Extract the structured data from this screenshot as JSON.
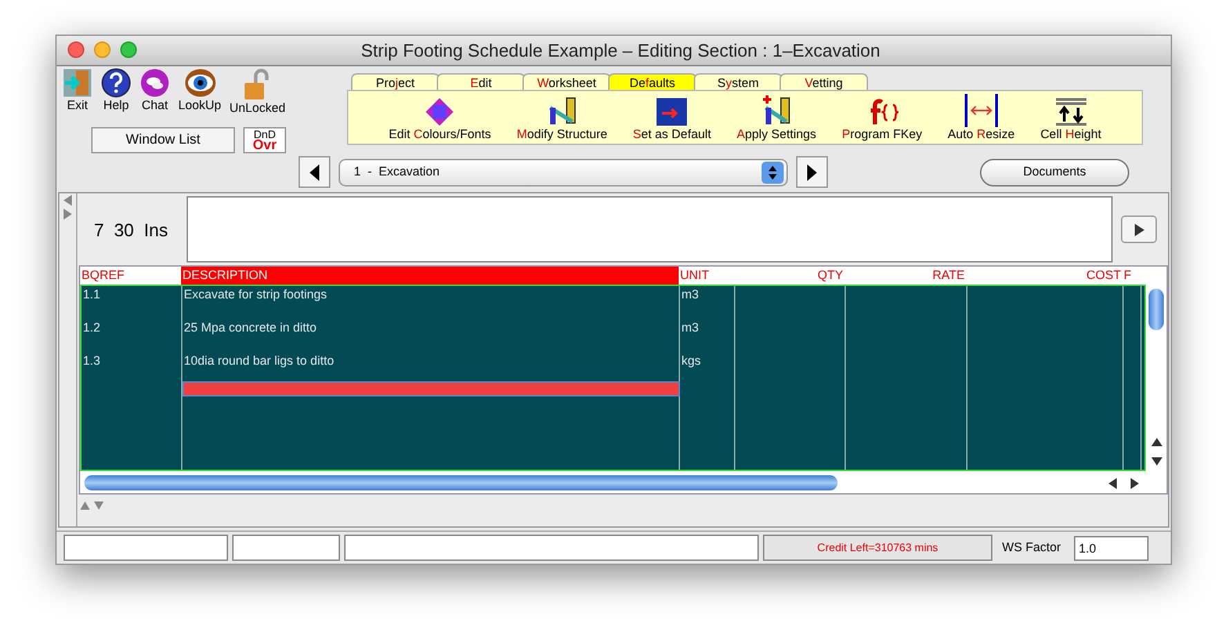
{
  "window": {
    "title": "Strip Footing Schedule Example – Editing Section : 1–Excavation"
  },
  "toolbar": {
    "buttons": [
      {
        "kind": "exit",
        "label": "Exit"
      },
      {
        "kind": "help",
        "label": "Help"
      },
      {
        "kind": "chat",
        "label": "Chat"
      },
      {
        "kind": "lookup",
        "label": "LookUp"
      },
      {
        "kind": "lock",
        "label": "UnLocked"
      }
    ],
    "window_list": "Window List",
    "dnd": {
      "top": "DnD",
      "bottom": "Ovr"
    }
  },
  "ribbon": {
    "tabs": [
      {
        "pre": "Pro",
        "key": "j",
        "post": "ect",
        "selected": false
      },
      {
        "key": "E",
        "post": "dit",
        "selected": false
      },
      {
        "key": "W",
        "post": "orksheet",
        "selected": false
      },
      {
        "pre": "De",
        "key": "f",
        "post": "aults",
        "selected": true
      },
      {
        "pre": "S",
        "key": "y",
        "post": "stem",
        "selected": false
      },
      {
        "key": "V",
        "post": "etting",
        "selected": false
      }
    ],
    "tools": [
      {
        "kind": "palette",
        "pre": "Edit ",
        "key": "C",
        "post": "olours/Fonts"
      },
      {
        "kind": "structure",
        "key": "M",
        "post": "odify Structure"
      },
      {
        "kind": "default",
        "key": "S",
        "post": "et as Default"
      },
      {
        "kind": "apply",
        "key": "A",
        "post": "pply Settings"
      },
      {
        "kind": "fkey",
        "key": "P",
        "post": "rogram FKey"
      },
      {
        "kind": "resize",
        "pre": "Auto ",
        "key": "R",
        "post": "esize"
      },
      {
        "kind": "height",
        "pre": "Cell ",
        "key": "H",
        "post": "eight"
      }
    ]
  },
  "navigator": {
    "section": "1  -  Excavation",
    "documents": "Documents"
  },
  "info": {
    "text": "7  30  Ins"
  },
  "grid": {
    "columns": [
      {
        "label": "BQREF",
        "kind": "text",
        "selected": false
      },
      {
        "label": "DESCRIPTION",
        "kind": "text",
        "selected": true
      },
      {
        "label": "UNIT",
        "kind": "text",
        "selected": false
      },
      {
        "label": "QTY",
        "kind": "number",
        "selected": false
      },
      {
        "label": "RATE",
        "kind": "number",
        "selected": false
      },
      {
        "label": "COST",
        "kind": "number",
        "selected": false
      },
      {
        "label": "F",
        "kind": "text",
        "selected": false
      }
    ],
    "rows": [
      {
        "cells": [
          "1.1",
          "Excavate for strip footings",
          "m3"
        ],
        "selected": false
      },
      {
        "cells": [
          "1.2",
          "25 Mpa concrete in ditto",
          "m3"
        ],
        "selected": false
      },
      {
        "cells": [
          "1.3",
          "10dia round bar ligs to ditto",
          "kgs"
        ],
        "selected": false
      },
      {
        "cells": [],
        "selected": true
      }
    ]
  },
  "status_bar": {
    "credit": "Credit Left=310763 mins",
    "ws_factor_label": "WS Factor",
    "ws_factor": "1.0"
  }
}
